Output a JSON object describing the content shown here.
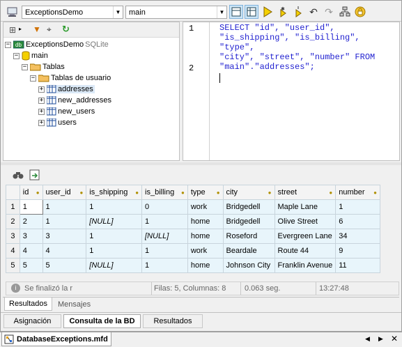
{
  "toolbar": {
    "datasource": "ExceptionsDemo",
    "schema": "main"
  },
  "tree": {
    "root": {
      "name": "ExceptionsDemo",
      "type": "SQLite"
    },
    "schema": "main",
    "folder_tables": "Tablas",
    "folder_user_tables": "Tablas de usuario",
    "tables": [
      "addresses",
      "new_addresses",
      "new_users",
      "users"
    ]
  },
  "editor": {
    "line_numbers": [
      "1",
      "2"
    ],
    "code_lines": [
      "SELECT \"id\", \"user_id\",",
      "\"is_shipping\", \"is_billing\", \"type\",",
      "\"city\", \"street\", \"number\" FROM",
      "\"main\".\"addresses\";"
    ]
  },
  "results": {
    "columns": [
      "id",
      "user_id",
      "is_shipping",
      "is_billing",
      "type",
      "city",
      "street",
      "number"
    ],
    "rows": [
      [
        "1",
        "1",
        "1",
        "0",
        "work",
        "Bridgedell",
        "Maple Lane",
        "1"
      ],
      [
        "2",
        "1",
        "[NULL]",
        "1",
        "home",
        "Bridgedell",
        "Olive Street",
        "6"
      ],
      [
        "3",
        "3",
        "1",
        "[NULL]",
        "home",
        "Roseford",
        "Evergreen Lane",
        "34"
      ],
      [
        "4",
        "4",
        "1",
        "1",
        "work",
        "Beardale",
        "Route 44",
        "9"
      ],
      [
        "5",
        "5",
        "[NULL]",
        "1",
        "home",
        "Johnson City",
        "Franklin Avenue",
        "11"
      ]
    ],
    "row_numbers": [
      "1",
      "2",
      "3",
      "4",
      "5"
    ]
  },
  "status": {
    "message": "Se finalizó la r",
    "counts": "Filas: 5, Columnas: 8",
    "duration": "0.063 seg.",
    "time": "13:27:48"
  },
  "result_tabs": [
    "Resultados",
    "Mensajes"
  ],
  "main_tabs": [
    "Asignación",
    "Consulta de la BD",
    "Resultados"
  ],
  "document": {
    "name": "DatabaseExceptions.mfd"
  },
  "colors": {
    "accent": "#1f1fd0",
    "grid_cell": "#e8f5fb",
    "selection": "#dbe9f7"
  }
}
